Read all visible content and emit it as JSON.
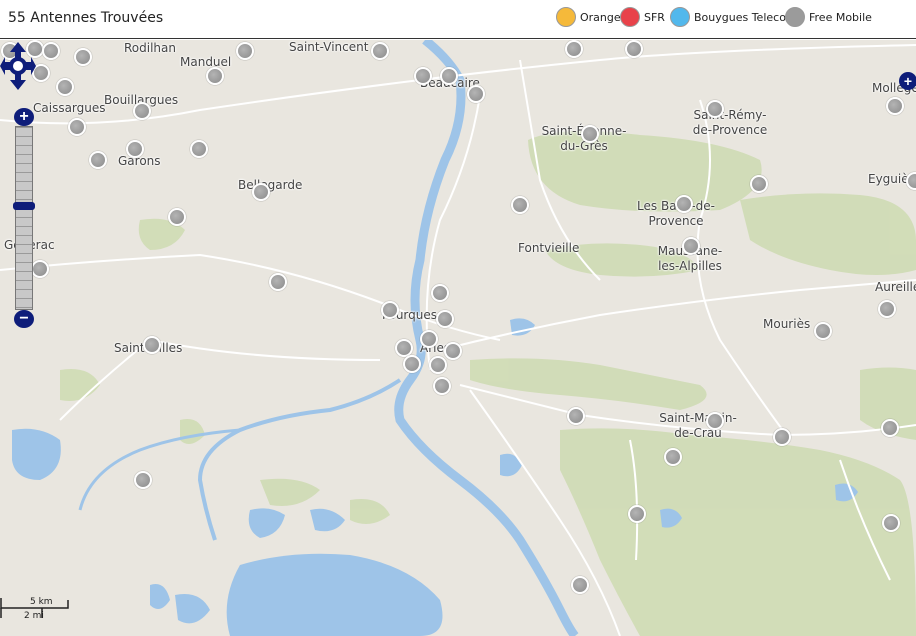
{
  "header": {
    "title": "55 Antennes Trouvées"
  },
  "legend": [
    {
      "label": "Orange",
      "color": "#f5b93a"
    },
    {
      "label": "SFR",
      "color": "#e8424a"
    },
    {
      "label": "Bouygues Telecom",
      "color": "#52b8ec"
    },
    {
      "label": "Free Mobile",
      "color": "#9b9b9b"
    }
  ],
  "places": [
    {
      "name": "Rodilhan"
    },
    {
      "name": "Saint-Vincent"
    },
    {
      "name": "Manduel"
    },
    {
      "name": "Beaucaire"
    },
    {
      "name": "Caissargues"
    },
    {
      "name": "Bouillargues"
    },
    {
      "name": "Garons"
    },
    {
      "name": "Bellegarde"
    },
    {
      "name": "Saint-Étienne-du-Grès"
    },
    {
      "name": "Saint-Rémy-de-Provence"
    },
    {
      "name": "Les Baux-de-Provence"
    },
    {
      "name": "Fontvieille"
    },
    {
      "name": "Maussane-les-Alpilles"
    },
    {
      "name": "Eyguières"
    },
    {
      "name": "Generac"
    },
    {
      "name": "Fourques"
    },
    {
      "name": "Arles"
    },
    {
      "name": "Saint-Gilles"
    },
    {
      "name": "Mouriès"
    },
    {
      "name": "Aureille"
    },
    {
      "name": "Saint-Martin-de-Crau"
    },
    {
      "name": "Mollégès"
    }
  ],
  "antenna_count": 55,
  "scale": {
    "top_label": "5 km",
    "bottom_label": "2 mi"
  },
  "icons": {
    "pan": "pan-arrows-icon",
    "zoom_in": "plus-icon",
    "zoom_out": "minus-icon"
  }
}
